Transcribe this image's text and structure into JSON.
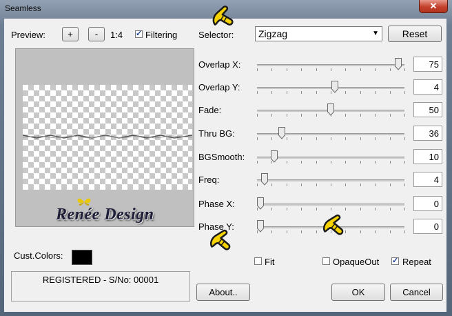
{
  "window": {
    "title": "Seamless",
    "close_label": "✕"
  },
  "preview": {
    "label": "Preview:",
    "zoom_in": "+",
    "zoom_out": "-",
    "zoom": "1:4",
    "filtering_label": "Filtering",
    "filtering_checked": true,
    "logo_text": "Renée Design"
  },
  "selector": {
    "label": "Selector:",
    "value": "Zigzag",
    "reset_label": "Reset"
  },
  "sliders": [
    {
      "label": "Overlap X:",
      "value": "75",
      "level": 0.98
    },
    {
      "label": "Overlap Y:",
      "value": "4",
      "level": 0.53
    },
    {
      "label": "Fade:",
      "value": "50",
      "level": 0.5
    },
    {
      "label": "Thru BG:",
      "value": "36",
      "level": 0.15
    },
    {
      "label": "BGSmooth:",
      "value": "10",
      "level": 0.1
    },
    {
      "label": "Freq:",
      "value": "4",
      "level": 0.03
    },
    {
      "label": "Phase X:",
      "value": "0",
      "level": 0.0
    },
    {
      "label": "Phase Y:",
      "value": "0",
      "level": 0.0
    }
  ],
  "cust_colors": {
    "label": "Cust.Colors:",
    "color": "#000000"
  },
  "registration": "REGISTERED - S/No: 00001",
  "options": {
    "fit_label": "Fit",
    "fit_checked": false,
    "opaqueout_label": "OpaqueOut",
    "opaqueout_checked": false,
    "repeat_label": "Repeat",
    "repeat_checked": true
  },
  "buttons": {
    "about": "About..",
    "ok": "OK",
    "cancel": "Cancel"
  }
}
